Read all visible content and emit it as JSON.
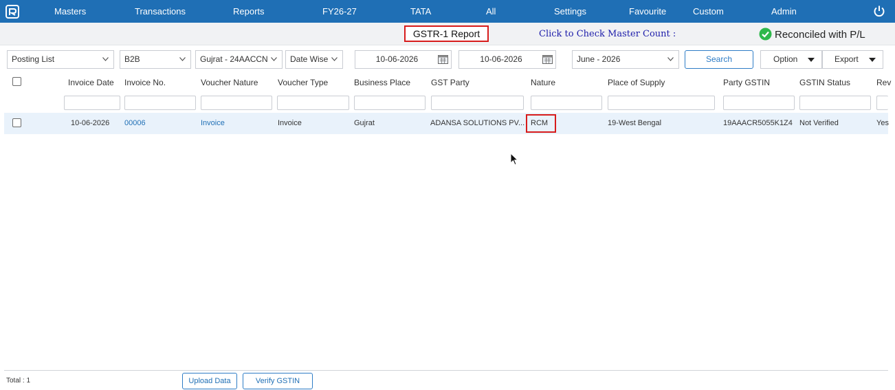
{
  "nav": {
    "items": [
      "Masters",
      "Transactions",
      "Reports",
      "FY26-27",
      "TATA",
      "All",
      "Settings",
      "Favourite",
      "Custom",
      "Admin"
    ],
    "logo_icon": "app-logo-icon",
    "power_icon": "power-icon",
    "bg_color": "#1f6fb5"
  },
  "subbar": {
    "report_title": "GSTR-1 Report",
    "master_count_label": "Click to Check Master Count :",
    "reconciled_label": "Reconciled with P/L",
    "reconciled_icon": "check-circle-icon",
    "reconciled_color": "#2eb84b"
  },
  "filters": {
    "list_type": "Posting List",
    "category": "B2B",
    "business_place": "Gujrat - 24AACCN",
    "date_mode": "Date Wise",
    "from_date": "10-06-2026",
    "to_date": "10-06-2026",
    "month": "June - 2026",
    "search_label": "Search",
    "option_label": "Option",
    "export_label": "Export"
  },
  "table": {
    "columns": [
      "Invoice Date",
      "Invoice No.",
      "Voucher Nature",
      "Voucher Type",
      "Business Place",
      "GST Party",
      "Nature",
      "Place of Supply",
      "Party GSTIN",
      "GSTIN Status",
      "Rev"
    ],
    "rows": [
      {
        "invoice_date": "10-06-2026",
        "invoice_no": "00006",
        "voucher_nature": "Invoice",
        "voucher_type": "Invoice",
        "business_place": "Gujrat",
        "gst_party": "ADANSA SOLUTIONS PV...",
        "nature": "RCM",
        "place_of_supply": "19-West Bengal",
        "party_gstin": "19AAACR5055K1Z4",
        "gstin_status": "Not Verified",
        "rev": "Yes"
      }
    ]
  },
  "footer": {
    "total": "Total : 1",
    "upload_label": "Upload Data",
    "verify_label": "Verify GSTIN"
  }
}
